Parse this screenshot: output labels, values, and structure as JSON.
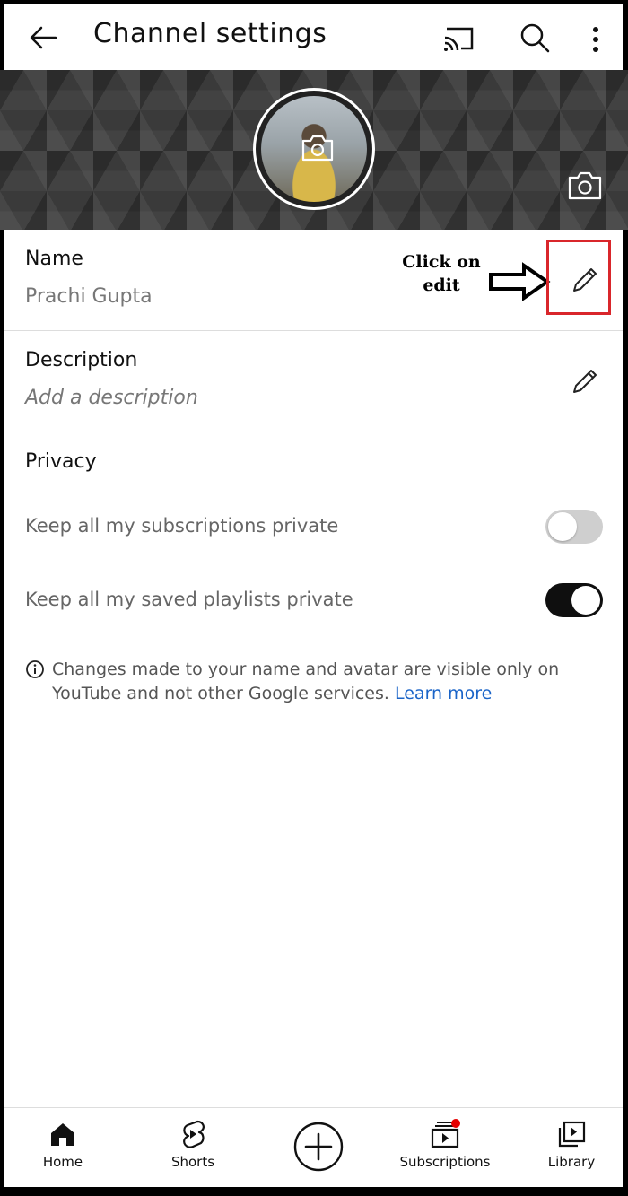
{
  "header": {
    "title": "Channel settings",
    "back_icon": "arrow-back-icon",
    "cast_icon": "cast-icon",
    "search_icon": "search-icon",
    "more_icon": "more-vert-icon"
  },
  "banner": {
    "avatar_camera_icon": "camera-icon",
    "banner_camera_icon": "camera-icon"
  },
  "fields": {
    "name": {
      "label": "Name",
      "value": "Prachi Gupta",
      "edit_icon": "pencil-icon"
    },
    "description": {
      "label": "Description",
      "placeholder": "Add a description",
      "edit_icon": "pencil-icon"
    }
  },
  "annotation": {
    "line1": "Click on",
    "line2": "edit",
    "highlight_color": "#d9262b"
  },
  "privacy": {
    "title": "Privacy",
    "options": [
      {
        "label": "Keep all my subscriptions private",
        "enabled": false
      },
      {
        "label": "Keep all my saved playlists private",
        "enabled": true
      }
    ]
  },
  "info": {
    "line1": "Changes made to your name and avatar are visible only on",
    "line2": "YouTube and not other Google services.",
    "link": "Learn more",
    "link_color": "#1a64c8"
  },
  "bottom_nav": {
    "items": [
      {
        "label": "Home",
        "icon": "home-icon"
      },
      {
        "label": "Shorts",
        "icon": "shorts-icon"
      },
      {
        "label": "",
        "icon": "create-plus-icon"
      },
      {
        "label": "Subscriptions",
        "icon": "subscriptions-icon"
      },
      {
        "label": "Library",
        "icon": "library-icon"
      }
    ]
  }
}
